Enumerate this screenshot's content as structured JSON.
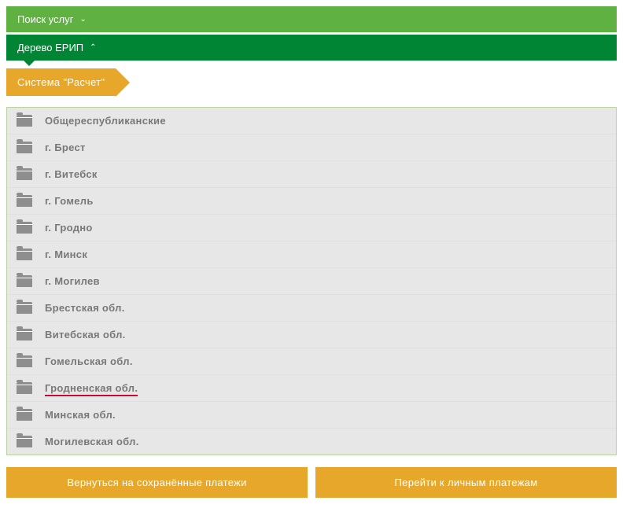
{
  "header": {
    "search_label": "Поиск услуг",
    "tree_label": "Дерево ЕРИП"
  },
  "breadcrumb": {
    "root": "Система \"Расчет\""
  },
  "tree": {
    "items": [
      {
        "label": "Общереспубликанские",
        "highlighted": false
      },
      {
        "label": "г. Брест",
        "highlighted": false
      },
      {
        "label": "г. Витебск",
        "highlighted": false
      },
      {
        "label": "г. Гомель",
        "highlighted": false
      },
      {
        "label": "г. Гродно",
        "highlighted": false
      },
      {
        "label": "г. Минск",
        "highlighted": false
      },
      {
        "label": "г. Могилев",
        "highlighted": false
      },
      {
        "label": "Брестская обл.",
        "highlighted": false
      },
      {
        "label": "Витебская обл.",
        "highlighted": false
      },
      {
        "label": "Гомельская обл.",
        "highlighted": false
      },
      {
        "label": "Гродненская обл.",
        "highlighted": true
      },
      {
        "label": "Минская обл.",
        "highlighted": false
      },
      {
        "label": "Могилевская обл.",
        "highlighted": false
      }
    ]
  },
  "footer": {
    "back_button": "Вернуться на сохранённые платежи",
    "personal_button": "Перейти к личным платежам"
  }
}
